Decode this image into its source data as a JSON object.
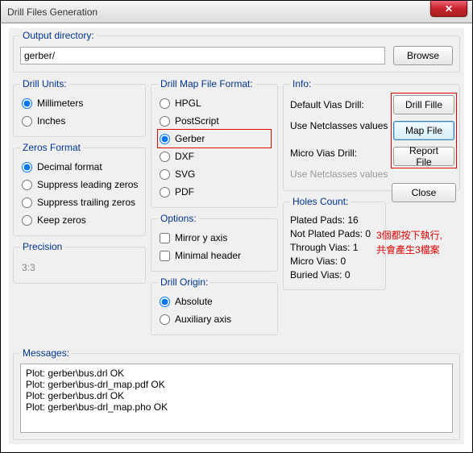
{
  "window": {
    "title": "Drill Files Generation"
  },
  "output": {
    "legend": "Output directory:",
    "value": "gerber/",
    "browse": "Browse"
  },
  "drill_units": {
    "legend": "Drill Units:",
    "mm": "Millimeters",
    "in": "Inches"
  },
  "zeros": {
    "legend": "Zeros Format",
    "dec": "Decimal format",
    "sl": "Suppress leading zeros",
    "st": "Suppress trailing zeros",
    "kz": "Keep zeros"
  },
  "precision": {
    "legend": "Precision",
    "value": "3:3"
  },
  "map": {
    "legend": "Drill Map File Format:",
    "hpgl": "HPGL",
    "ps": "PostScript",
    "gerber": "Gerber",
    "dxf": "DXF",
    "svg": "SVG",
    "pdf": "PDF"
  },
  "options": {
    "legend": "Options:",
    "mirror": "Mirror y axis",
    "minhdr": "Minimal header"
  },
  "origin": {
    "legend": "Drill Origin:",
    "abs": "Absolute",
    "aux": "Auxiliary axis"
  },
  "info": {
    "legend": "Info:",
    "default_vias": "Default Vias Drill:",
    "use_netclasses": "Use Netclasses values",
    "micro_vias": "Micro Vias Drill:",
    "use_netclasses2": "Use Netclasses values"
  },
  "buttons": {
    "drill": "Drill Fille",
    "map": "Map File",
    "report": "Report File",
    "close": "Close"
  },
  "holes": {
    "legend": "Holes Count:",
    "plated": "Plated Pads: 16",
    "notplated": "Not Plated Pads: 0",
    "through": "Through Vias: 1",
    "micro": "Micro Vias: 0",
    "buried": "Buried Vias: 0"
  },
  "annot": {
    "line1": "3個都按下執行,",
    "line2": "共會產生3檔案"
  },
  "messages": {
    "legend": "Messages:",
    "text": "Plot: gerber\\bus.drl OK\nPlot: gerber\\bus-drl_map.pdf OK\nPlot: gerber\\bus.drl OK\nPlot: gerber\\bus-drl_map.pho OK"
  }
}
